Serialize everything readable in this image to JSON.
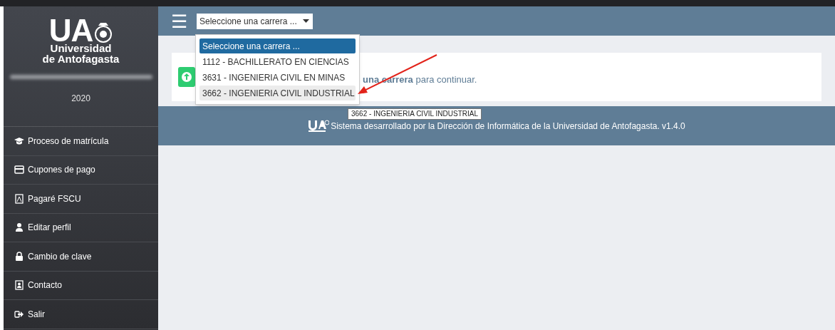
{
  "sidebar": {
    "logo": {
      "initials": "UA",
      "line_1": "Universidad",
      "line_2": "de Antofagasta"
    },
    "year": "2020",
    "items": [
      {
        "label": "Proceso de matrícula"
      },
      {
        "label": "Cupones de pago"
      },
      {
        "label": "Pagaré FSCU"
      },
      {
        "label": "Editar perfil"
      },
      {
        "label": "Cambio de clave"
      },
      {
        "label": "Contacto"
      },
      {
        "label": "Salir"
      }
    ]
  },
  "header": {
    "menu_icon": "☰",
    "select": {
      "value": "Seleccione una carrera ...",
      "expanded": true,
      "options": [
        {
          "label": "Seleccione una carrera ...",
          "selected": true,
          "hovered": false
        },
        {
          "label": "1112 - BACHILLERATO EN CIENCIAS",
          "selected": false,
          "hovered": false
        },
        {
          "label": "3631 - INGENIERIA CIVIL EN MINAS",
          "selected": false,
          "hovered": false
        },
        {
          "label": "3662 - INGENIERIA CIVIL INDUSTRIAL",
          "selected": false,
          "hovered": true
        }
      ]
    }
  },
  "notice": {
    "text": "**una carrera** para continuar."
  },
  "tooltip": "3662 - INGENIERIA CIVIL INDUSTRIAL",
  "footer": {
    "text": "Sistema desarrollado por la Dirección de Informática de la Universidad de Antofagasta. v1.4.0"
  }
}
